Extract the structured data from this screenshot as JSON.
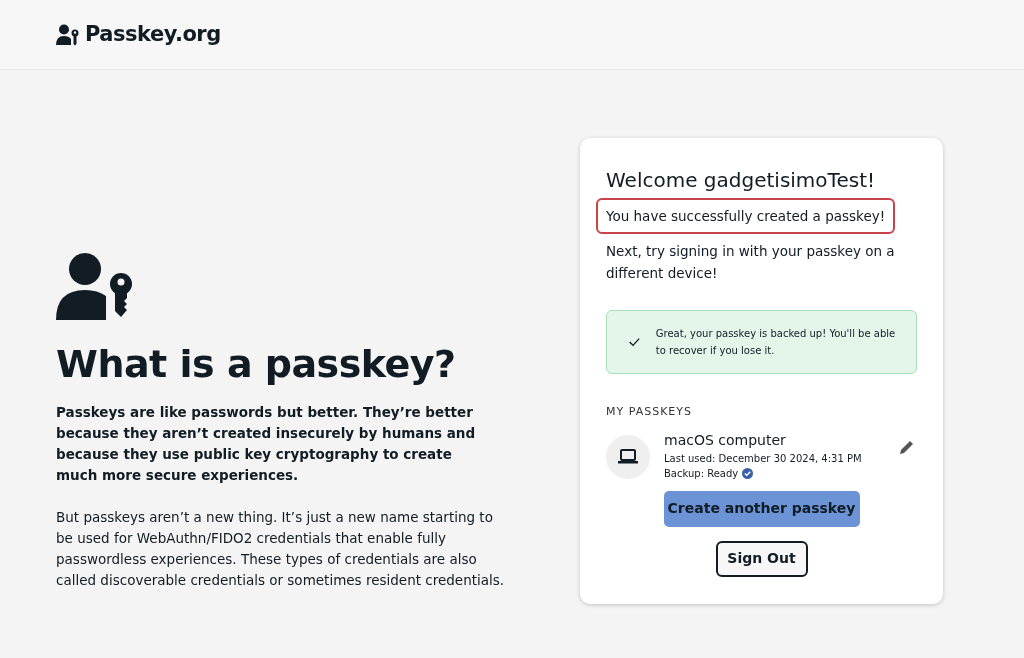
{
  "header": {
    "logo_text": "Passkey.org"
  },
  "intro": {
    "heading": "What is a passkey?",
    "lead": "Passkeys are like passwords but better. They’re better because they aren’t created insecurely by humans and because they use public key cryptography to create much more secure experiences.",
    "body": "But passkeys aren’t a new thing. It’s just a new name starting to be used for WebAuthn/FIDO2 credentials that enable fully passwordless experiences. These types of credentials are also called discoverable credentials or sometimes resident credentials."
  },
  "card": {
    "title": "Welcome gadgetisimoTest!",
    "success_message": {
      "text": "You have successfully created a passkey!",
      "highlighted": true
    },
    "next_hint": "Next, try signing in with your passkey on a different device!",
    "backup_notice": "Great, your passkey is backed up! You'll be able to recover if you lose it.",
    "section_title": "MY PASSKEYS",
    "passkeys": [
      {
        "name": "macOS computer",
        "last_used": "Last used: December 30 2024, 4:31 PM",
        "backup": "Backup: Ready",
        "backup_verified": true
      }
    ],
    "buttons": [
      {
        "label": "Create another passkey",
        "kind": "primary"
      },
      {
        "label": "Sign Out",
        "kind": "outline"
      }
    ]
  }
}
